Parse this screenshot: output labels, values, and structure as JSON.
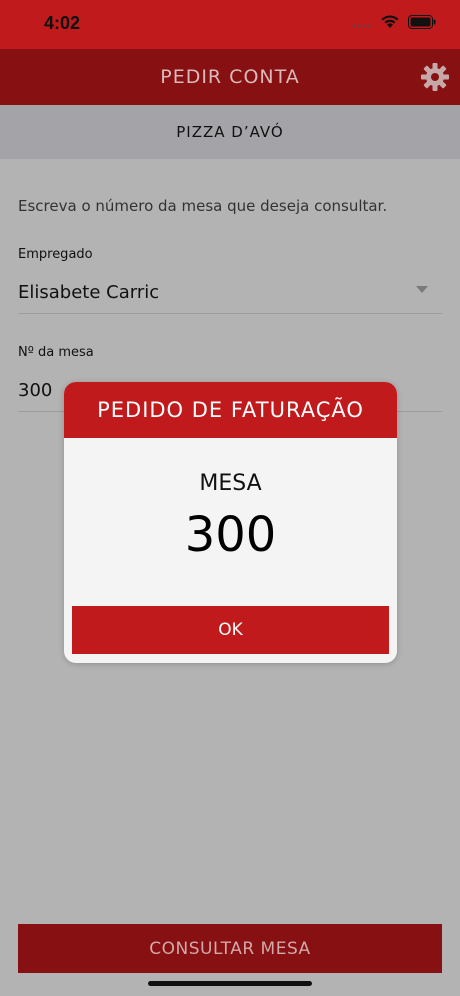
{
  "status_bar": {
    "time": "4:02"
  },
  "nav": {
    "title": "PEDIR CONTA",
    "settings_icon": "gear-icon"
  },
  "restaurant": {
    "name": "PIZZA D’AVÓ"
  },
  "form": {
    "instruction": "Escreva o número da mesa que deseja consultar.",
    "employee": {
      "label": "Empregado",
      "value": "Elisabete Carric"
    },
    "table": {
      "label": "Nº da mesa",
      "value": "300"
    }
  },
  "bottom_button": {
    "label": "CONSULTAR MESA"
  },
  "dialog": {
    "title": "PEDIDO DE FATURAÇÃO",
    "label": "MESA",
    "number": "300",
    "ok_label": "OK"
  },
  "colors": {
    "primary_red": "#c01a1c",
    "dark_red": "#871012",
    "overlay_gray": "#b3b3b3"
  }
}
